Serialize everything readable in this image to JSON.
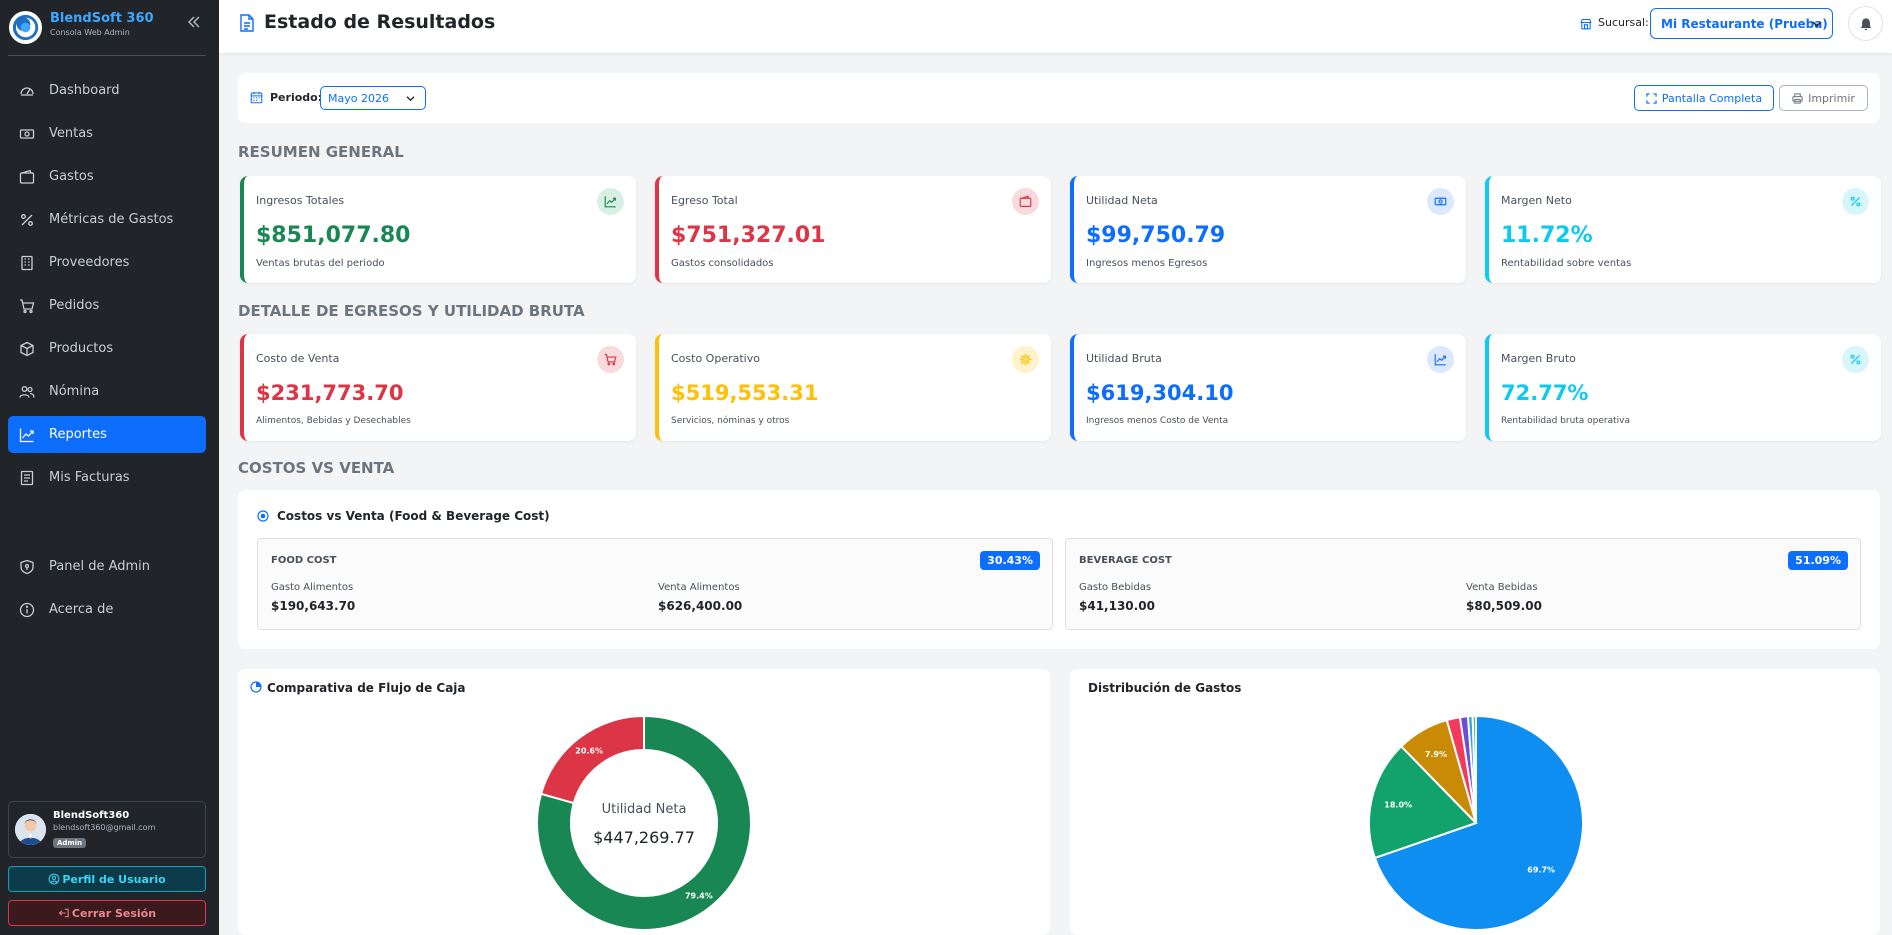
{
  "app": {
    "name": "BlendSoft 360",
    "subtitle": "Consola Web Admin"
  },
  "sidebar": {
    "items": [
      {
        "label": "Dashboard",
        "icon": "gauge-icon"
      },
      {
        "label": "Ventas",
        "icon": "cash-icon"
      },
      {
        "label": "Gastos",
        "icon": "wallet-icon"
      },
      {
        "label": "Métricas de Gastos",
        "icon": "percent-icon"
      },
      {
        "label": "Proveedores",
        "icon": "building-icon"
      },
      {
        "label": "Pedidos",
        "icon": "cart-icon"
      },
      {
        "label": "Productos",
        "icon": "box-icon"
      },
      {
        "label": "Nómina",
        "icon": "people-icon"
      },
      {
        "label": "Reportes",
        "icon": "graph-up-icon",
        "active": true
      },
      {
        "label": "Mis Facturas",
        "icon": "receipt-icon"
      }
    ],
    "secondary": [
      {
        "label": "Panel de Admin",
        "icon": "shield-icon"
      },
      {
        "label": "Acerca de",
        "icon": "info-icon"
      }
    ],
    "user": {
      "name": "BlendSoft360",
      "email": "blendsoft360@gmail.com",
      "role": "Admin"
    },
    "profile_label": "Perfil de Usuario",
    "logout_label": "Cerrar Sesión"
  },
  "header": {
    "title": "Estado de Resultados",
    "branch_label": "Sucursal:",
    "branch_value": "Mi Restaurante (Prueba)"
  },
  "toolbar": {
    "period_label": "Periodo:",
    "period_value": "Mayo 2026",
    "fullscreen_label": "Pantalla Completa",
    "print_label": "Imprimir"
  },
  "sections": {
    "summary": "RESUMEN GENERAL",
    "detail": "DETALLE DE EGRESOS Y UTILIDAD BRUTA",
    "costs": "COSTOS VS VENTA"
  },
  "summary_cards": [
    {
      "label": "Ingresos Totales",
      "value": "$851,077.80",
      "sub": "Ventas brutas del periodo",
      "color": "#198754",
      "icon": "graph-up-icon"
    },
    {
      "label": "Egreso Total",
      "value": "$751,327.01",
      "sub": "Gastos consolidados",
      "color": "#dc3545",
      "icon": "wallet-icon"
    },
    {
      "label": "Utilidad Neta",
      "value": "$99,750.79",
      "sub": "Ingresos menos Egresos",
      "color": "#0d6efd",
      "icon": "cash-icon"
    },
    {
      "label": "Margen Neto",
      "value": "11.72%",
      "sub": "Rentabilidad sobre ventas",
      "color": "#0dcaf0",
      "icon": "percent-icon"
    }
  ],
  "detail_cards": [
    {
      "label": "Costo de Venta",
      "value": "$231,773.70",
      "sub": "Alimentos, Bebidas y Desechables",
      "color": "#dc3545",
      "icon": "cart-icon"
    },
    {
      "label": "Costo Operativo",
      "value": "$519,553.31",
      "sub": "Servicios, nóminas y otros",
      "color": "#ffc107",
      "icon": "gear-icon"
    },
    {
      "label": "Utilidad Bruta",
      "value": "$619,304.10",
      "sub": "Ingresos menos Costo de Venta",
      "color": "#0d6efd",
      "icon": "graph-up-icon"
    },
    {
      "label": "Margen Bruto",
      "value": "72.77%",
      "sub": "Rentabilidad bruta operativa",
      "color": "#0dcaf0",
      "icon": "percent-icon"
    }
  ],
  "food_beverage": {
    "title": "Costos vs Venta (Food & Beverage Cost)",
    "food": {
      "title": "FOOD COST",
      "pct": "30.43%",
      "expense_label": "Gasto Alimentos",
      "expense": "$190,643.70",
      "sales_label": "Venta Alimentos",
      "sales": "$626,400.00"
    },
    "beverage": {
      "title": "BEVERAGE COST",
      "pct": "51.09%",
      "expense_label": "Gasto Bebidas",
      "expense": "$41,130.00",
      "sales_label": "Venta Bebidas",
      "sales": "$80,509.00"
    }
  },
  "cashflow": {
    "title": "Comparativa de Flujo de Caja",
    "center_label": "Utilidad Neta",
    "center_value": "$447,269.77"
  },
  "distribution": {
    "title": "Distribución de Gastos"
  },
  "chart_data": [
    {
      "type": "pie",
      "variant": "donut",
      "title": "Comparativa de Flujo de Caja",
      "series": [
        {
          "value": 79.4,
          "label": "79.4%",
          "color": "#198754"
        },
        {
          "value": 20.6,
          "label": "20.6%",
          "color": "#dc3545"
        }
      ]
    },
    {
      "type": "pie",
      "title": "Distribución de Gastos",
      "series": [
        {
          "value": 69.7,
          "label": "69.7%",
          "color": "#0d8ef0"
        },
        {
          "value": 18.0,
          "label": "18.0%",
          "color": "#12a36c"
        },
        {
          "value": 7.9,
          "label": "7.9%",
          "color": "#c98a06"
        },
        {
          "value": 2.0,
          "label": "",
          "color": "#f23b5c"
        },
        {
          "value": 1.2,
          "label": "",
          "color": "#6d4fd6"
        },
        {
          "value": 0.7,
          "label": "",
          "color": "#28a4e8"
        },
        {
          "value": 0.5,
          "label": "",
          "color": "#3abf9a"
        }
      ]
    }
  ]
}
